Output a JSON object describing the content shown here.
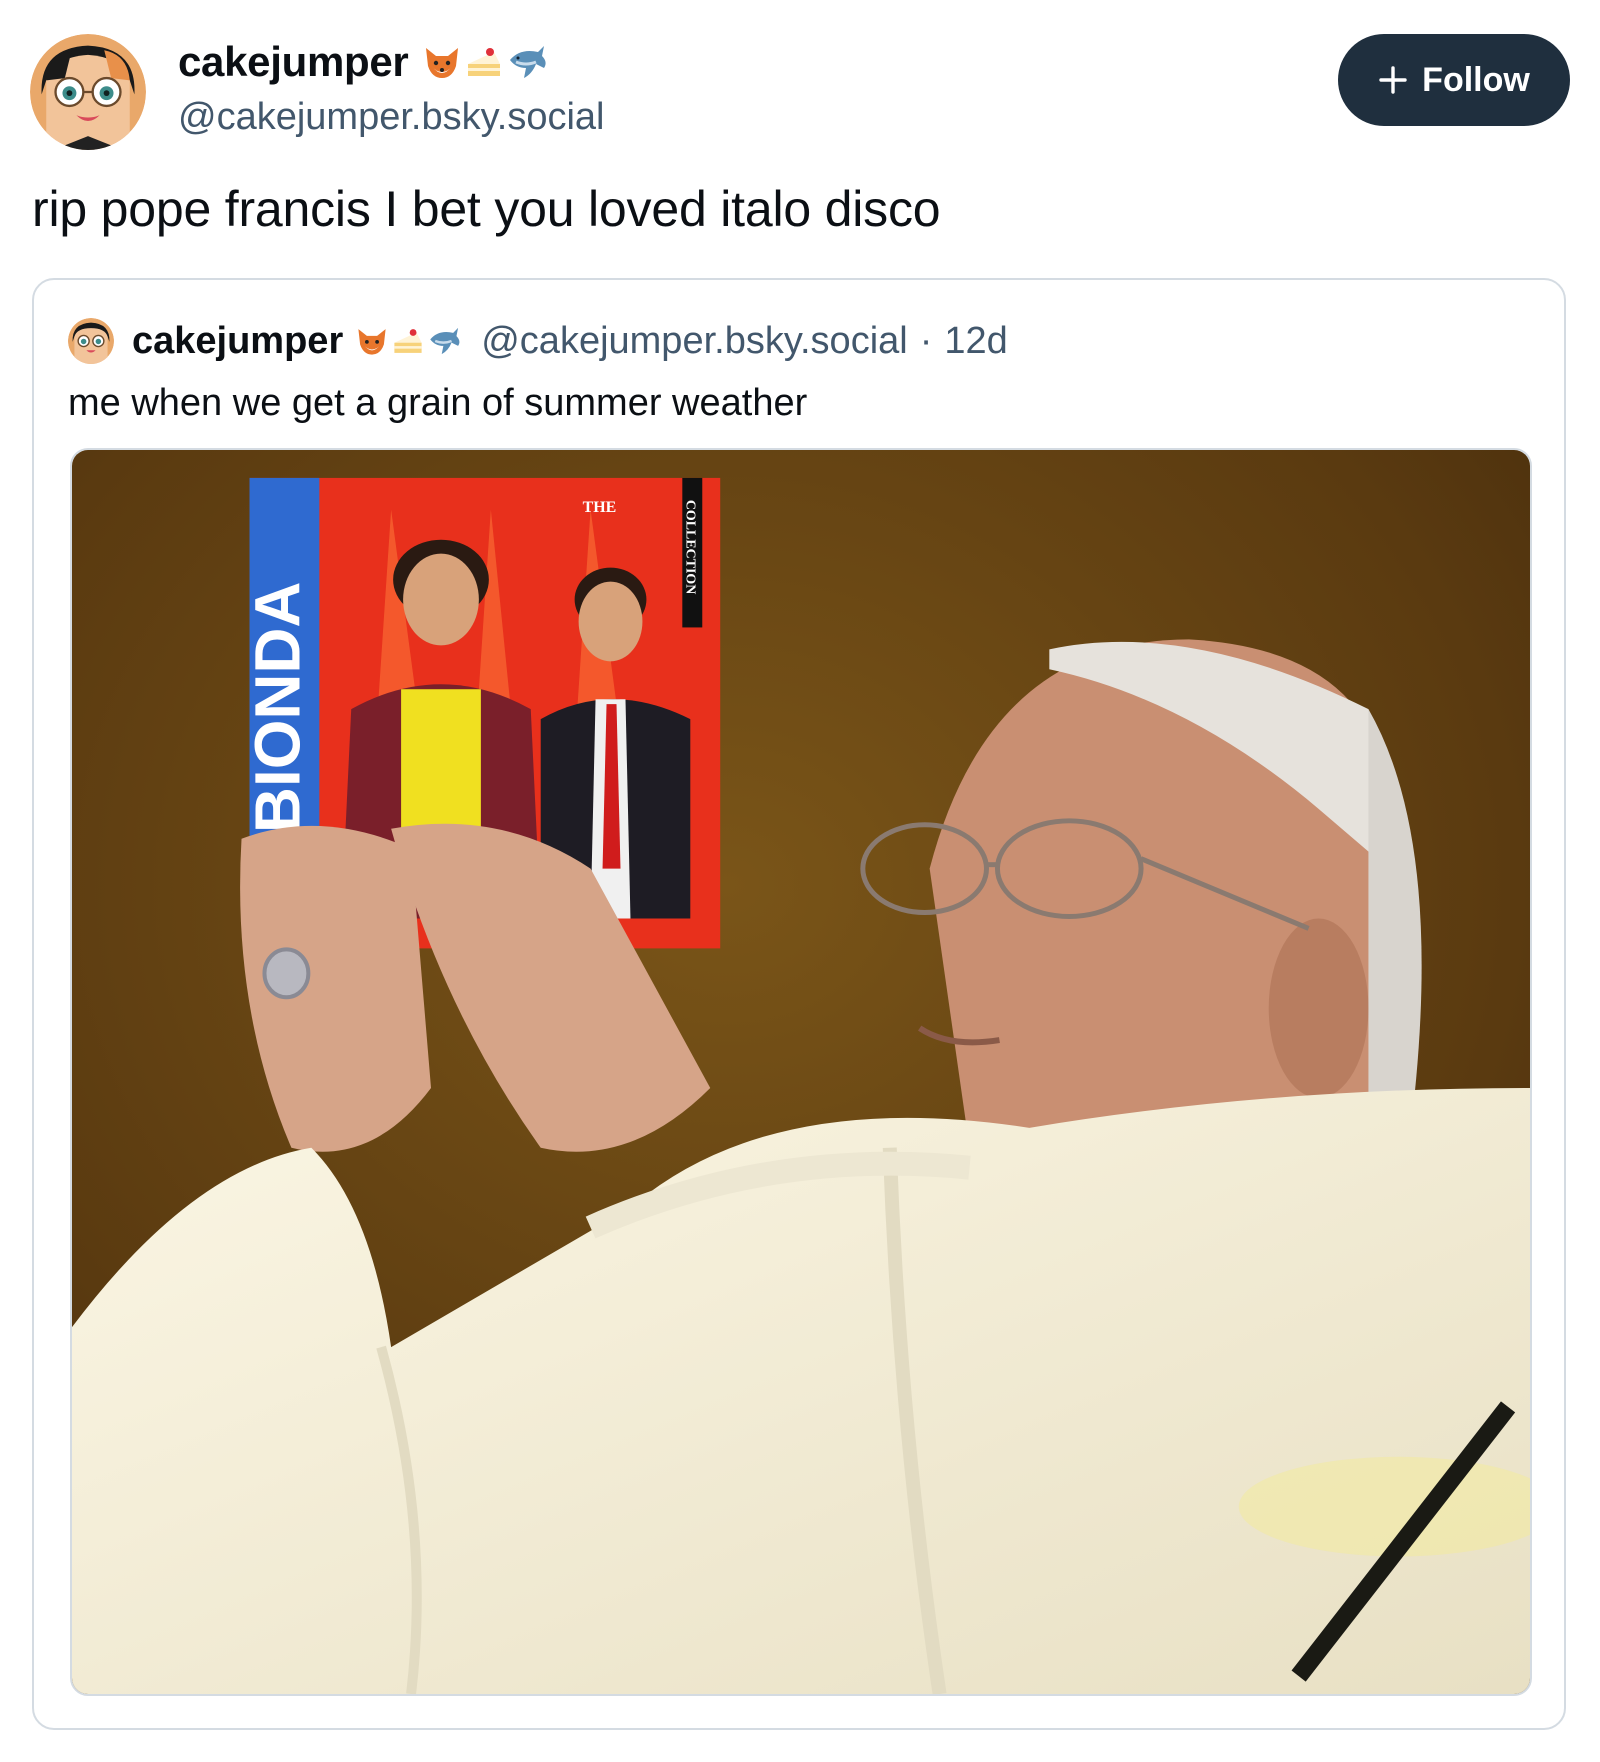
{
  "post": {
    "author": {
      "display_name": "cakejumper",
      "handle": "@cakejumper.bsky.social",
      "emojis": [
        "fox-emoji",
        "cake-emoji",
        "dolphin-emoji"
      ]
    },
    "follow_button": {
      "label": "Follow",
      "icon": "plus-icon"
    },
    "text": "rip pope francis I bet you loved italo disco"
  },
  "quote": {
    "author": {
      "display_name": "cakejumper",
      "handle": "@cakejumper.bsky.social",
      "emojis": [
        "fox-emoji",
        "cake-emoji",
        "dolphin-emoji"
      ]
    },
    "separator": "·",
    "time": "12d",
    "text": "me when we get a grain of summer weather",
    "media": {
      "album_band": "LA BIONDA",
      "album_the": "THE",
      "album_collection": "COLLECTION"
    }
  },
  "colors": {
    "follow_bg": "#1f2f3e",
    "handle_gray": "#42576c",
    "card_border": "#d4dbe2"
  }
}
